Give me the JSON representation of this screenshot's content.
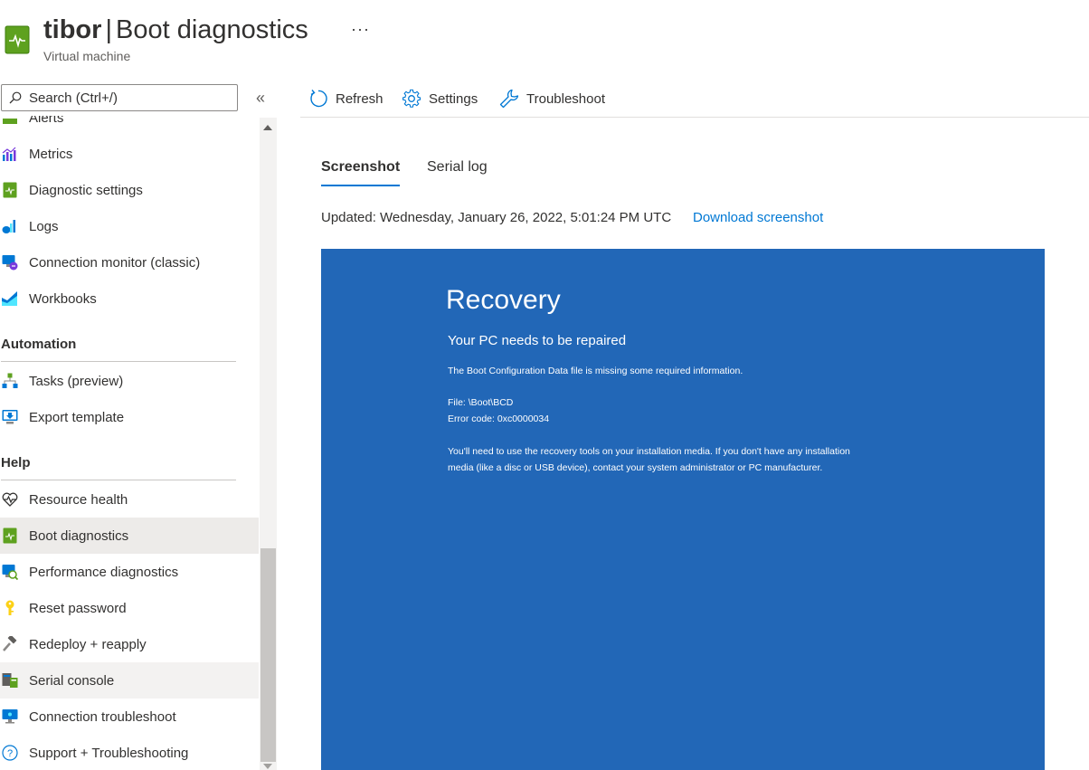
{
  "header": {
    "resource_name": "tibor",
    "separator": "|",
    "blade_title": "Boot diagnostics",
    "more_label": "···",
    "subtitle": "Virtual machine"
  },
  "search": {
    "placeholder": "Search (Ctrl+/)"
  },
  "collapse_label": "«",
  "sidebar": {
    "items_top": [
      {
        "label": "Alerts",
        "icon": "alerts-icon"
      },
      {
        "label": "Metrics",
        "icon": "metrics-icon"
      },
      {
        "label": "Diagnostic settings",
        "icon": "diagnostic-settings-icon"
      },
      {
        "label": "Logs",
        "icon": "logs-icon"
      },
      {
        "label": "Connection monitor (classic)",
        "icon": "connection-monitor-icon"
      },
      {
        "label": "Workbooks",
        "icon": "workbooks-icon"
      }
    ],
    "automation": {
      "title": "Automation",
      "items": [
        {
          "label": "Tasks (preview)",
          "icon": "tasks-icon"
        },
        {
          "label": "Export template",
          "icon": "export-template-icon"
        }
      ]
    },
    "help": {
      "title": "Help",
      "items": [
        {
          "label": "Resource health",
          "icon": "resource-health-icon"
        },
        {
          "label": "Boot diagnostics",
          "icon": "boot-diagnostics-icon"
        },
        {
          "label": "Performance diagnostics",
          "icon": "performance-diagnostics-icon"
        },
        {
          "label": "Reset password",
          "icon": "key-icon"
        },
        {
          "label": "Redeploy + reapply",
          "icon": "hammer-icon"
        },
        {
          "label": "Serial console",
          "icon": "serial-console-icon"
        },
        {
          "label": "Connection troubleshoot",
          "icon": "connection-troubleshoot-icon"
        },
        {
          "label": "Support + Troubleshooting",
          "icon": "help-icon"
        }
      ]
    }
  },
  "toolbar": {
    "refresh_label": "Refresh",
    "settings_label": "Settings",
    "troubleshoot_label": "Troubleshoot"
  },
  "tabs": [
    {
      "label": "Screenshot",
      "active": true
    },
    {
      "label": "Serial log",
      "active": false
    }
  ],
  "updated_text": "Updated: Wednesday, January 26, 2022, 5:01:24 PM UTC",
  "download_label": "Download screenshot",
  "screenshot": {
    "background": "#2267b7",
    "title": "Recovery",
    "subtitle": "Your PC needs to be repaired",
    "message": "The Boot Configuration Data file is missing some required information.",
    "file_line": "File: \\Boot\\BCD",
    "error_line": "Error code: 0xc0000034",
    "instructions_1": "You'll need to use the recovery tools on your installation media. If you don't have any installation",
    "instructions_2": "media (like a disc or USB device), contact your system administrator or PC manufacturer."
  },
  "colors": {
    "accent": "#0078d4",
    "selected_bg": "#edebe9",
    "vm_green": "#5ea11f"
  }
}
